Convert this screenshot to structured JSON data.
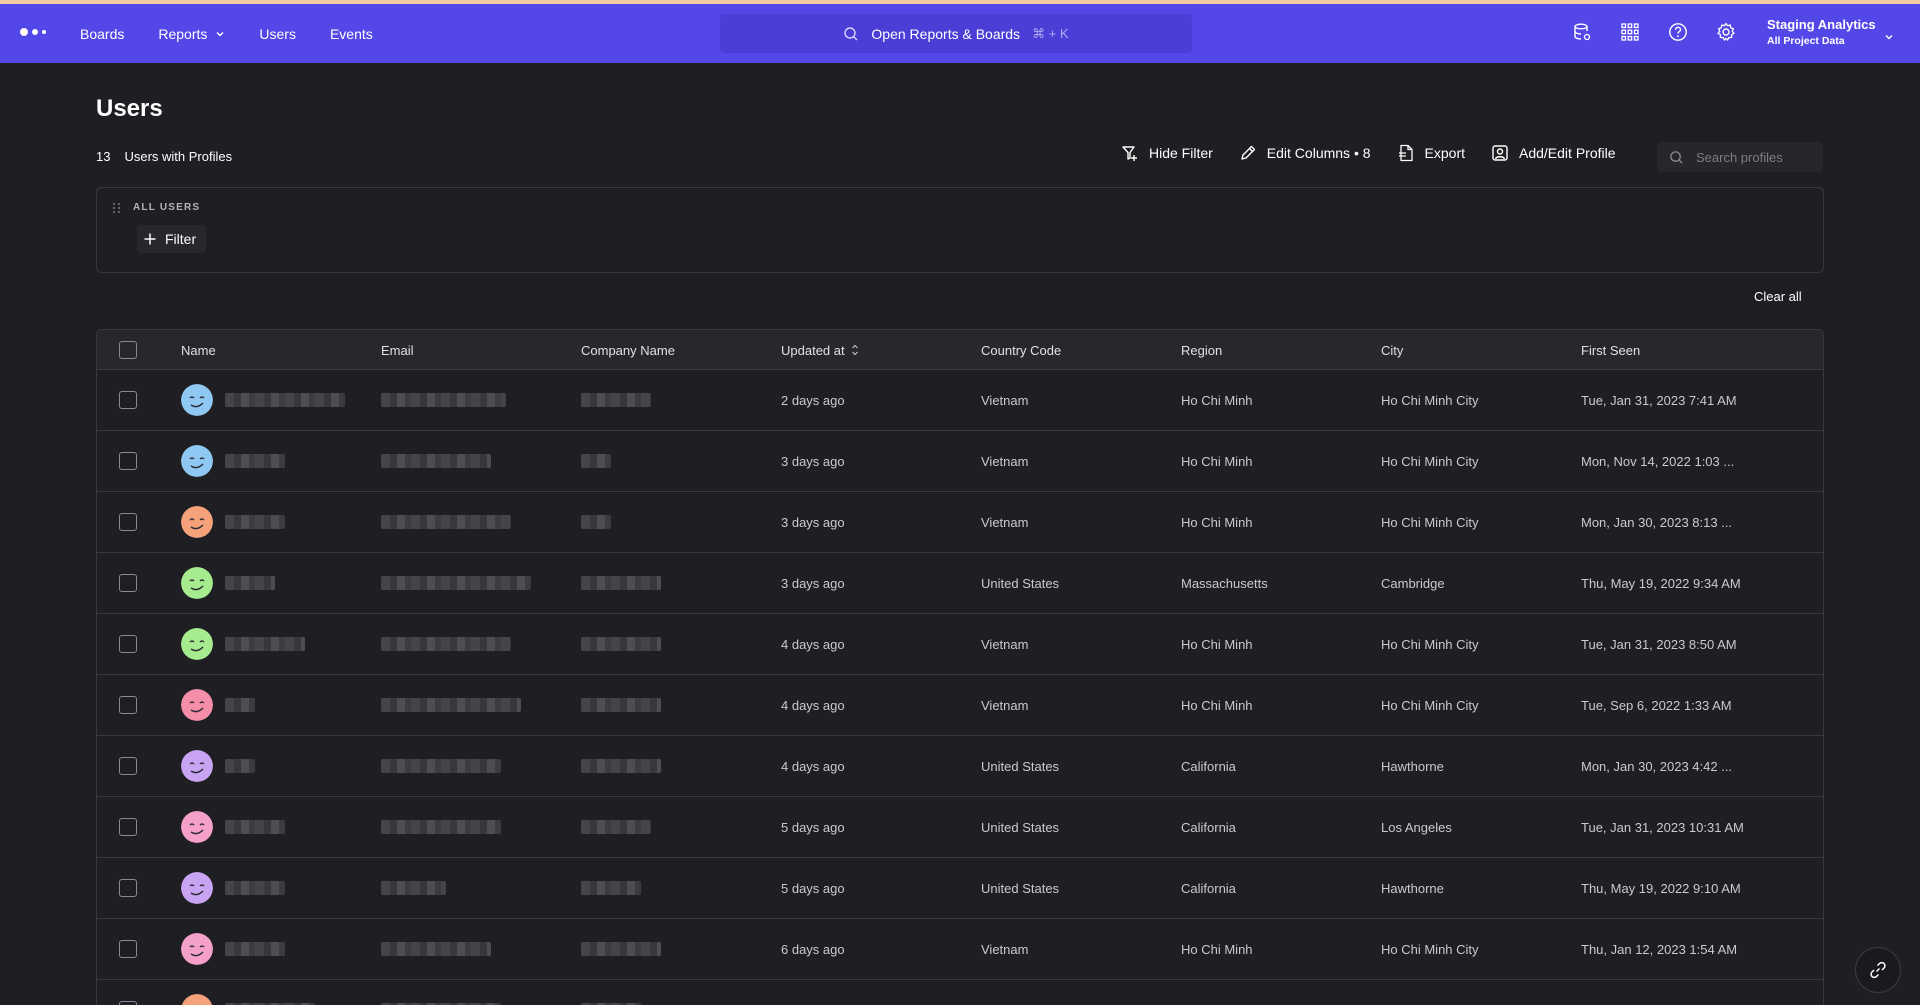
{
  "nav": {
    "items": [
      {
        "label": "Boards"
      },
      {
        "label": "Reports",
        "has_dropdown": true
      },
      {
        "label": "Users"
      },
      {
        "label": "Events"
      }
    ],
    "search_label": "Open Reports & Boards",
    "search_shortcut": "⌘ + K",
    "icons": [
      "database-settings-icon",
      "apps-grid-icon",
      "help-icon",
      "settings-icon"
    ],
    "project_name": "Staging Analytics",
    "project_scope": "All Project Data"
  },
  "page": {
    "title": "Users",
    "profile_count": "13",
    "profile_count_label": "Users with Profiles"
  },
  "toolbar": {
    "hide_filter": "Hide Filter",
    "edit_columns": "Edit Columns • 8",
    "export": "Export",
    "add_edit_profile": "Add/Edit Profile",
    "search_placeholder": "Search profiles"
  },
  "filter_panel": {
    "group_label": "ALL USERS",
    "filter_button": "Filter",
    "clear_all": "Clear all"
  },
  "table": {
    "columns": [
      "Name",
      "Email",
      "Company Name",
      "Updated at",
      "Country Code",
      "Region",
      "City",
      "First Seen"
    ],
    "sorted_column": "Updated at",
    "rows": [
      {
        "updated": "2 days ago",
        "country": "Vietnam",
        "region": "Ho Chi Minh",
        "city": "Ho Chi Minh City",
        "first_seen": "Tue, Jan 31, 2023 7:41 AM",
        "avatar_color": "#8fc8f2"
      },
      {
        "updated": "3 days ago",
        "country": "Vietnam",
        "region": "Ho Chi Minh",
        "city": "Ho Chi Minh City",
        "first_seen": "Mon, Nov 14, 2022 1:03 ...",
        "avatar_color": "#8fc8f2"
      },
      {
        "updated": "3 days ago",
        "country": "Vietnam",
        "region": "Ho Chi Minh",
        "city": "Ho Chi Minh City",
        "first_seen": "Mon, Jan 30, 2023 8:13 ...",
        "avatar_color": "#f5a27a"
      },
      {
        "updated": "3 days ago",
        "country": "United States",
        "region": "Massachusetts",
        "city": "Cambridge",
        "first_seen": "Thu, May 19, 2022 9:34 AM",
        "avatar_color": "#a6ec8e"
      },
      {
        "updated": "4 days ago",
        "country": "Vietnam",
        "region": "Ho Chi Minh",
        "city": "Ho Chi Minh City",
        "first_seen": "Tue, Jan 31, 2023 8:50 AM",
        "avatar_color": "#a6ec8e"
      },
      {
        "updated": "4 days ago",
        "country": "Vietnam",
        "region": "Ho Chi Minh",
        "city": "Ho Chi Minh City",
        "first_seen": "Tue, Sep 6, 2022 1:33 AM",
        "avatar_color": "#f58ea8"
      },
      {
        "updated": "4 days ago",
        "country": "United States",
        "region": "California",
        "city": "Hawthorne",
        "first_seen": "Mon, Jan 30, 2023 4:42 ...",
        "avatar_color": "#c9a4f2"
      },
      {
        "updated": "5 days ago",
        "country": "United States",
        "region": "California",
        "city": "Los Angeles",
        "first_seen": "Tue, Jan 31, 2023 10:31 AM",
        "avatar_color": "#f5a0c8"
      },
      {
        "updated": "5 days ago",
        "country": "United States",
        "region": "California",
        "city": "Hawthorne",
        "first_seen": "Thu, May 19, 2022 9:10 AM",
        "avatar_color": "#c9a4f2"
      },
      {
        "updated": "6 days ago",
        "country": "Vietnam",
        "region": "Ho Chi Minh",
        "city": "Ho Chi Minh City",
        "first_seen": "Thu, Jan 12, 2023 1:54 AM",
        "avatar_color": "#f5a0c8"
      },
      {
        "updated": "",
        "country": "",
        "region": "",
        "city": "",
        "first_seen": "",
        "avatar_color": "#f5a27a"
      }
    ]
  },
  "fab": {
    "icon": "link-icon"
  }
}
